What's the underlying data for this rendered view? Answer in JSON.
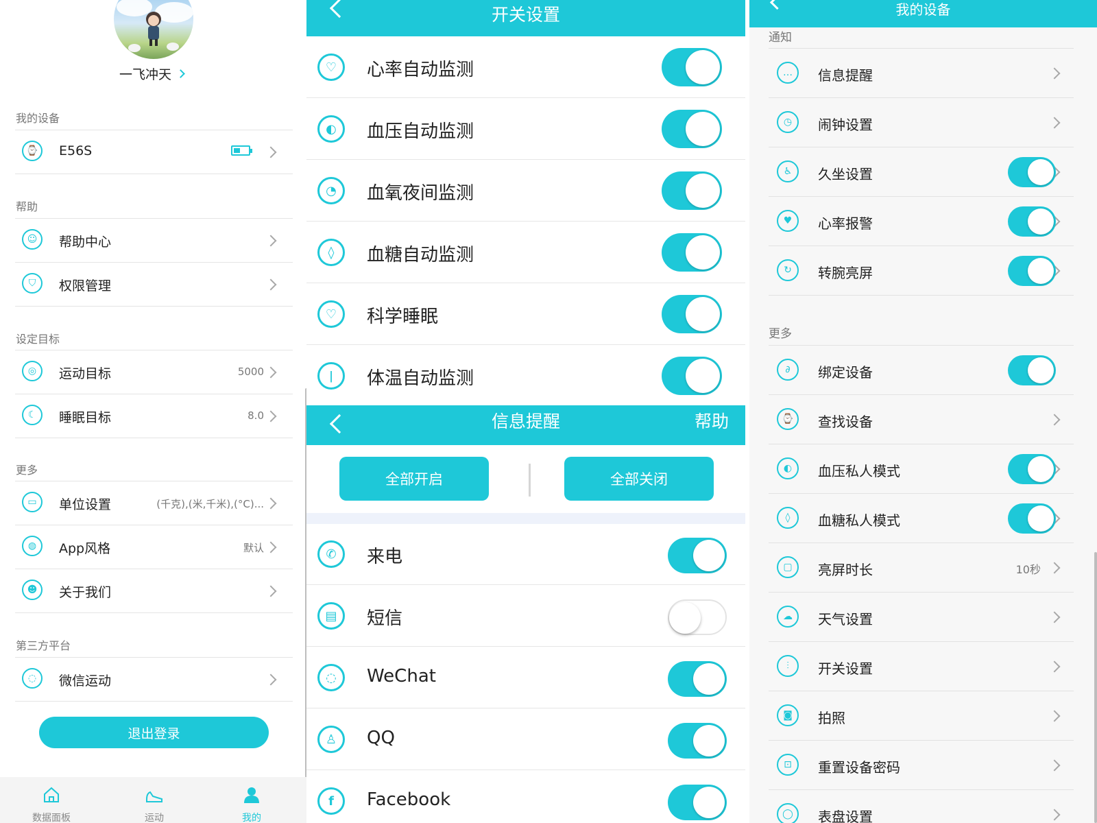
{
  "theme": {
    "accent": "#1ec8d8",
    "divider": "#e4e4e4"
  },
  "profile": {
    "username": "一飞冲天",
    "sections": {
      "device": "我的设备",
      "help": "帮助",
      "goal": "设定目标",
      "more": "更多",
      "third": "第三方平台"
    },
    "rows": {
      "device": {
        "label": "E56S",
        "icon": "watch-icon"
      },
      "help_center": {
        "label": "帮助中心",
        "icon": "support-icon"
      },
      "permission": {
        "label": "权限管理",
        "icon": "shield-icon"
      },
      "sport_goal": {
        "label": "运动目标",
        "value": "5000",
        "icon": "target-icon"
      },
      "sleep_goal": {
        "label": "睡眠目标",
        "value": "8.0",
        "icon": "moon-icon"
      },
      "units": {
        "label": "单位设置",
        "value": "(千克),(米,千米),(°C)...",
        "icon": "ruler-icon"
      },
      "app_style": {
        "label": "App风格",
        "value": "默认",
        "icon": "palette-icon"
      },
      "about": {
        "label": "关于我们",
        "icon": "people-icon"
      },
      "wechat_sport": {
        "label": "微信运动",
        "icon": "wechat-icon"
      }
    },
    "logout": "退出登录",
    "tabs": [
      {
        "label": "数据面板",
        "icon": "home-icon"
      },
      {
        "label": "运动",
        "icon": "shoe-icon"
      },
      {
        "label": "我的",
        "icon": "person-icon"
      }
    ]
  },
  "switch_settings": {
    "title": "开关设置",
    "items": [
      {
        "label": "心率自动监测",
        "icon": "heart-rate-icon",
        "on": true
      },
      {
        "label": "血压自动监测",
        "icon": "blood-pressure-icon",
        "on": true
      },
      {
        "label": "血氧夜间监测",
        "icon": "blood-oxygen-icon",
        "on": true
      },
      {
        "label": "血糖自动监测",
        "icon": "blood-sugar-icon",
        "on": true
      },
      {
        "label": "科学睡眠",
        "icon": "sleep-heart-icon",
        "on": true
      },
      {
        "label": "体温自动监测",
        "icon": "thermometer-icon",
        "on": true
      }
    ]
  },
  "message_reminder": {
    "title": "信息提醒",
    "help": "帮助",
    "enable_all": "全部开启",
    "disable_all": "全部关闭",
    "items": [
      {
        "label": "来电",
        "icon": "phone-icon",
        "on": true
      },
      {
        "label": "短信",
        "icon": "sms-icon",
        "on": false
      },
      {
        "label": "WeChat",
        "icon": "wechat-icon",
        "on": true
      },
      {
        "label": "QQ",
        "icon": "qq-icon",
        "on": true
      },
      {
        "label": "Facebook",
        "icon": "facebook-icon",
        "on": true
      }
    ]
  },
  "my_device": {
    "title": "我的设备",
    "sections": {
      "notify": "通知",
      "more": "更多"
    },
    "notify_items": [
      {
        "label": "信息提醒",
        "icon": "message-icon",
        "type": "link"
      },
      {
        "label": "闹钟设置",
        "icon": "alarm-icon",
        "type": "link"
      },
      {
        "label": "久坐设置",
        "icon": "sedentary-icon",
        "type": "toggle",
        "on": true
      },
      {
        "label": "心率报警",
        "icon": "heart-alarm-icon",
        "type": "toggle",
        "on": true
      },
      {
        "label": "转腕亮屏",
        "icon": "wrist-turn-icon",
        "type": "toggle",
        "on": true
      }
    ],
    "more_items": [
      {
        "label": "绑定设备",
        "icon": "link-icon",
        "type": "toggle",
        "on": true
      },
      {
        "label": "查找设备",
        "icon": "find-watch-icon",
        "type": "link"
      },
      {
        "label": "血压私人模式",
        "icon": "blood-pressure-icon",
        "type": "toggle",
        "on": true
      },
      {
        "label": "血糖私人模式",
        "icon": "blood-sugar-icon",
        "type": "toggle",
        "on": true
      },
      {
        "label": "亮屏时长",
        "icon": "screen-time-icon",
        "type": "link",
        "value": "10秒"
      },
      {
        "label": "天气设置",
        "icon": "weather-icon",
        "type": "link"
      },
      {
        "label": "开关设置",
        "icon": "sliders-icon",
        "type": "link"
      },
      {
        "label": "拍照",
        "icon": "camera-icon",
        "type": "link"
      },
      {
        "label": "重置设备密码",
        "icon": "lock-icon",
        "type": "link"
      },
      {
        "label": "表盘设置",
        "icon": "watchface-icon",
        "type": "link"
      }
    ]
  }
}
